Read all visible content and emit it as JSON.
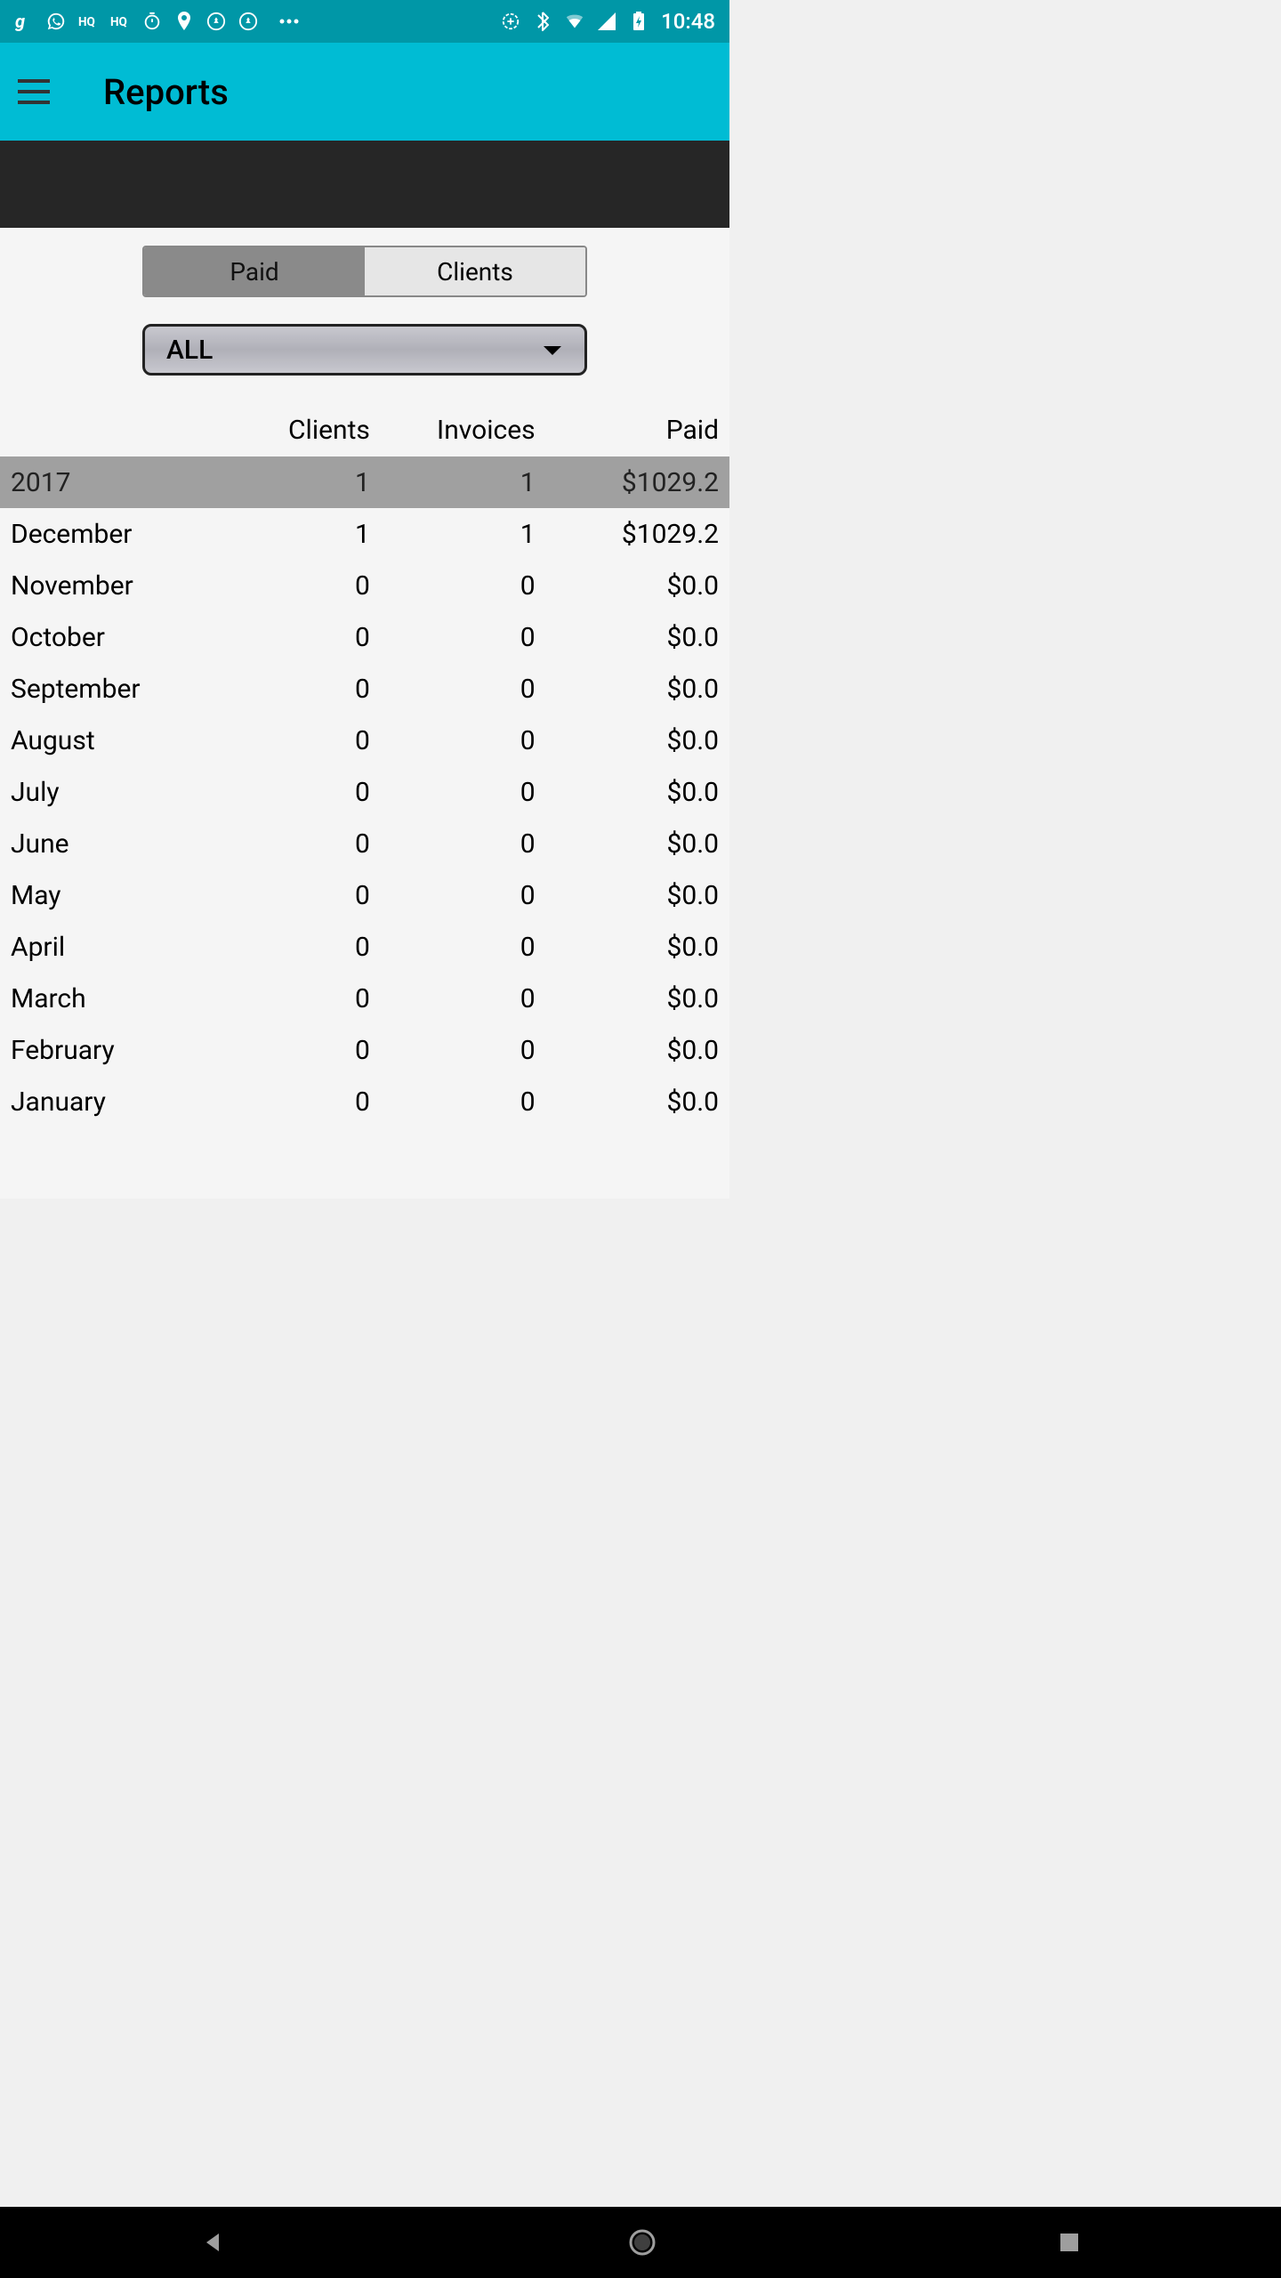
{
  "status_bar": {
    "time": "10:48"
  },
  "app_bar": {
    "title": "Reports"
  },
  "tabs": {
    "paid": "Paid",
    "clients": "Clients"
  },
  "dropdown": {
    "selected": "ALL"
  },
  "table": {
    "headers": {
      "clients": "Clients",
      "invoices": "Invoices",
      "paid": "Paid"
    },
    "summary": {
      "label": "2017",
      "clients": "1",
      "invoices": "1",
      "paid": "$1029.2"
    },
    "rows": [
      {
        "label": "December",
        "clients": "1",
        "invoices": "1",
        "paid": "$1029.2"
      },
      {
        "label": "November",
        "clients": "0",
        "invoices": "0",
        "paid": "$0.0"
      },
      {
        "label": "October",
        "clients": "0",
        "invoices": "0",
        "paid": "$0.0"
      },
      {
        "label": "September",
        "clients": "0",
        "invoices": "0",
        "paid": "$0.0"
      },
      {
        "label": "August",
        "clients": "0",
        "invoices": "0",
        "paid": "$0.0"
      },
      {
        "label": "July",
        "clients": "0",
        "invoices": "0",
        "paid": "$0.0"
      },
      {
        "label": "June",
        "clients": "0",
        "invoices": "0",
        "paid": "$0.0"
      },
      {
        "label": "May",
        "clients": "0",
        "invoices": "0",
        "paid": "$0.0"
      },
      {
        "label": "April",
        "clients": "0",
        "invoices": "0",
        "paid": "$0.0"
      },
      {
        "label": "March",
        "clients": "0",
        "invoices": "0",
        "paid": "$0.0"
      },
      {
        "label": "February",
        "clients": "0",
        "invoices": "0",
        "paid": "$0.0"
      },
      {
        "label": "January",
        "clients": "0",
        "invoices": "0",
        "paid": "$0.0"
      }
    ]
  }
}
